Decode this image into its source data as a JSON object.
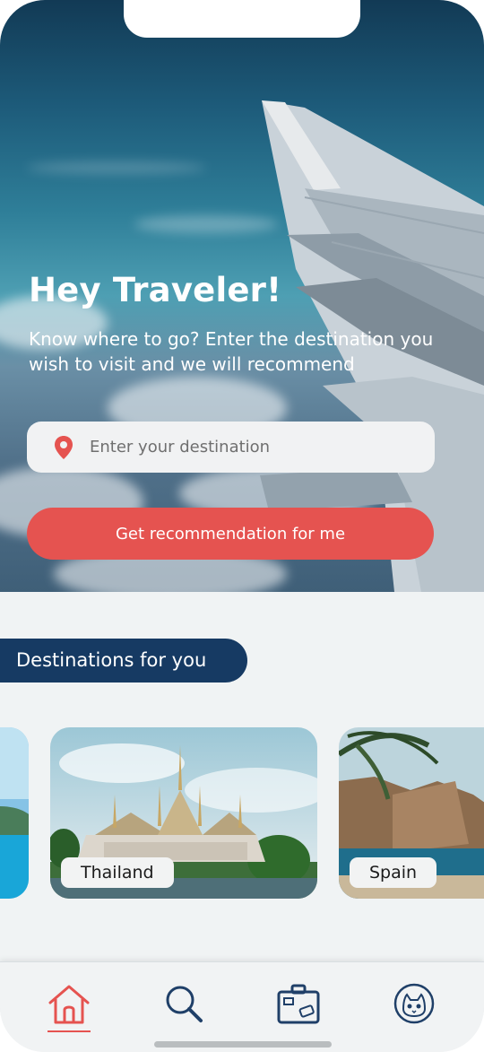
{
  "hero": {
    "title": "Hey Traveler!",
    "subtitle": "Know where to go? Enter the destination you wish to visit and we will recommend"
  },
  "search": {
    "placeholder": "Enter your destination",
    "value": ""
  },
  "cta": {
    "label": "Get recommendation for me"
  },
  "section": {
    "title": "Destinations for you"
  },
  "destinations": [
    {
      "label": ""
    },
    {
      "label": "Thailand"
    },
    {
      "label": "Spain"
    }
  ],
  "nav": {
    "items": [
      {
        "icon": "home-icon",
        "active": true
      },
      {
        "icon": "search-icon",
        "active": false
      },
      {
        "icon": "suitcase-icon",
        "active": false
      },
      {
        "icon": "profile-cat-icon",
        "active": false
      }
    ]
  },
  "colors": {
    "accent": "#e55350",
    "navy": "#163a63",
    "icon": "#1f3f68",
    "background": "#f0f3f4"
  }
}
